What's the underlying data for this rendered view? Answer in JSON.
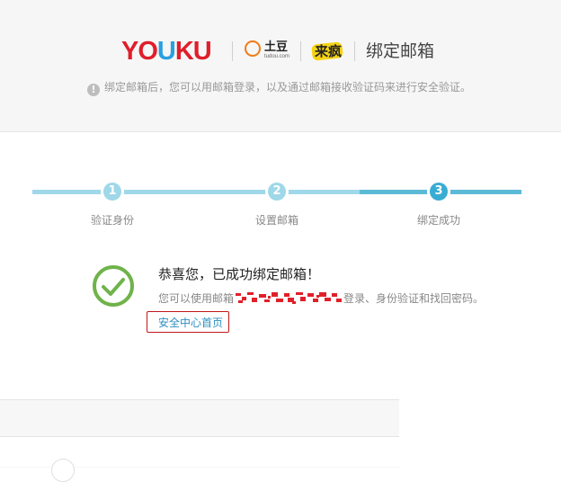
{
  "header": {
    "brand_youku": "YOUKU",
    "brand_tudou": "土豆",
    "brand_tudou_domain": "tudou.com",
    "brand_laifeng": "来疯",
    "title": "绑定邮箱",
    "notice": "绑定邮箱后，您可以用邮箱登录，以及通过邮箱接收验证码来进行安全验证。",
    "notice_icon": "exclamation-icon"
  },
  "steps": [
    {
      "number": "1",
      "label": "验证身份",
      "state": "done"
    },
    {
      "number": "2",
      "label": "设置邮箱",
      "state": "done"
    },
    {
      "number": "3",
      "label": "绑定成功",
      "state": "active"
    }
  ],
  "success": {
    "icon": "check-circle-icon",
    "title": "恭喜您，已成功绑定邮箱！",
    "desc_prefix": "您可以使用邮箱",
    "desc_suffix": "登录、身份验证和找回密码。",
    "link_label": "安全中心首页"
  },
  "colors": {
    "youku_red": "#e01e2b",
    "youku_blue": "#2aa0e0",
    "step_light": "#9fd8e8",
    "step_active": "#39acd3",
    "check_green": "#6fb34a",
    "link_blue": "#2d8fc2",
    "highlight_red": "#c0191b"
  }
}
